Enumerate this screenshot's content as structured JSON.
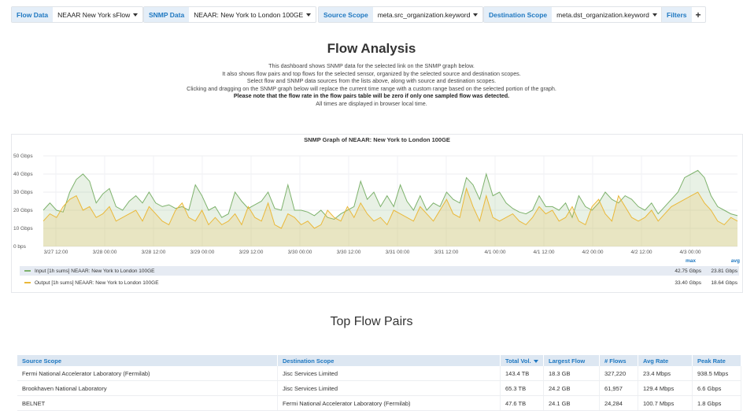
{
  "variables": {
    "flow": {
      "label": "Flow Data",
      "value": "NEAAR New York sFlow"
    },
    "snmp": {
      "label": "SNMP Data",
      "value": "NEAAR: New York to London 100GE"
    },
    "src": {
      "label": "Source Scope",
      "value": "meta.src_organization.keyword"
    },
    "dst": {
      "label": "Destination Scope",
      "value": "meta.dst_organization.keyword"
    },
    "filters": {
      "label": "Filters",
      "add": "+"
    }
  },
  "dashboard": {
    "title": "Flow Analysis",
    "desc": [
      "This dashboard shows SNMP data for the selected link on the SNMP graph below.",
      "It also shows flow pairs and top flows for the selected sensor, organized by the selected source and destination scopes.",
      "Select flow and SNMP data sources from the lists above, along with source and destination scopes.",
      "Clicking and dragging on the SNMP graph below will replace the current time range with a custom range based on the selected portion of the graph."
    ],
    "note": "Please note that the flow rate in the flow pairs table will be zero if only one sampled flow was detected.",
    "tz": "All times are displayed in browser local time."
  },
  "snmp_panel": {
    "title": "SNMP Graph of NEAAR: New York to London 100GE",
    "legend_headers": {
      "max": "max",
      "avg": "avg"
    },
    "legend": [
      {
        "name": "Input [1h sums] NEAAR: New York to London 100GE",
        "max": "42.75 Gbps",
        "avg": "23.81 Gbps",
        "color": "#7eb26d"
      },
      {
        "name": "Output [1h sums] NEAAR: New York to London 100GE",
        "max": "33.40 Gbps",
        "avg": "18.64 Gbps",
        "color": "#eab839"
      }
    ]
  },
  "chart_data": {
    "type": "area",
    "title": "SNMP Graph of NEAAR: New York to London 100GE",
    "y_ticks": [
      "0 bps",
      "10 Gbps",
      "20 Gbps",
      "30 Gbps",
      "40 Gbps",
      "50 Gbps"
    ],
    "x_ticks": [
      "3/27 12:00",
      "3/28 00:00",
      "3/28 12:00",
      "3/29 00:00",
      "3/29 12:00",
      "3/30 00:00",
      "3/30 12:00",
      "3/31 00:00",
      "3/31 12:00",
      "4/1 00:00",
      "4/1 12:00",
      "4/2 00:00",
      "4/2 12:00",
      "4/3 00:00"
    ],
    "ylim": [
      0,
      50
    ],
    "series": [
      {
        "name": "Input [1h sums] NEAAR: New York to London 100GE",
        "color": "#7eb26d",
        "values": [
          20,
          24,
          20,
          19,
          30,
          37,
          40,
          36,
          24,
          29,
          32,
          22,
          20,
          25,
          28,
          24,
          30,
          24,
          22,
          23,
          21,
          22,
          20,
          34,
          28,
          20,
          22,
          16,
          18,
          30,
          25,
          21,
          23,
          25,
          30,
          21,
          20,
          34,
          20,
          20,
          19,
          17,
          20,
          16,
          15,
          18,
          20,
          22,
          36,
          26,
          30,
          22,
          28,
          22,
          34,
          25,
          20,
          28,
          20,
          24,
          22,
          30,
          26,
          24,
          38,
          34,
          26,
          40,
          28,
          30,
          24,
          21,
          19,
          18,
          20,
          28,
          22,
          22,
          20,
          24,
          16,
          28,
          22,
          20,
          24,
          30,
          26,
          24,
          28,
          26,
          22,
          20,
          24,
          18,
          22,
          26,
          30,
          38,
          40,
          42,
          38,
          28,
          22,
          20,
          18,
          17
        ]
      },
      {
        "name": "Output [1h sums] NEAAR: New York to London 100GE",
        "color": "#eab839",
        "values": [
          14,
          18,
          16,
          22,
          26,
          28,
          20,
          22,
          16,
          18,
          22,
          14,
          16,
          18,
          20,
          14,
          22,
          18,
          14,
          12,
          20,
          24,
          16,
          14,
          20,
          12,
          16,
          12,
          14,
          18,
          12,
          22,
          16,
          14,
          24,
          12,
          10,
          18,
          16,
          12,
          14,
          10,
          12,
          20,
          16,
          14,
          22,
          16,
          24,
          18,
          14,
          16,
          12,
          20,
          18,
          16,
          14,
          22,
          18,
          14,
          20,
          26,
          18,
          16,
          32,
          22,
          14,
          28,
          16,
          14,
          16,
          18,
          14,
          12,
          16,
          22,
          18,
          20,
          14,
          16,
          22,
          14,
          12,
          22,
          26,
          18,
          14,
          28,
          22,
          16,
          14,
          16,
          20,
          14,
          18,
          22,
          24,
          26,
          28,
          30,
          24,
          20,
          14,
          12,
          16,
          14
        ]
      }
    ]
  },
  "pairs": {
    "title": "Top Flow Pairs",
    "columns": [
      "Source Scope",
      "Destination Scope",
      "Total Vol.",
      "Largest Flow",
      "# Flows",
      "Avg Rate",
      "Peak Rate"
    ],
    "rows": [
      [
        "Fermi National Accelerator Laboratory (Fermilab)",
        "Jisc Services Limited",
        "143.4 TB",
        "18.3 GB",
        "327,220",
        "23.4 Mbps",
        "938.5 Mbps"
      ],
      [
        "Brookhaven National Laboratory",
        "Jisc Services Limited",
        "65.3 TB",
        "24.2 GB",
        "61,957",
        "129.4 Mbps",
        "6.6 Gbps"
      ],
      [
        "BELNET",
        "Fermi National Accelerator Laboratory (Fermilab)",
        "47.6 TB",
        "24.1 GB",
        "24,284",
        "100.7 Mbps",
        "1.8 Gbps"
      ]
    ]
  }
}
